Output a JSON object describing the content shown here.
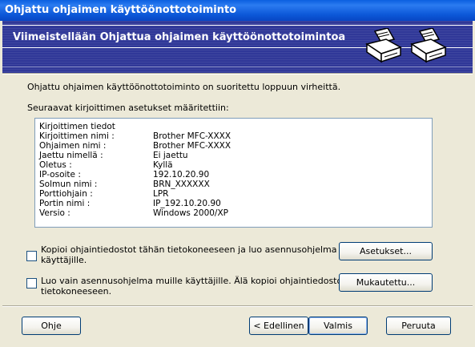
{
  "window": {
    "title": "Ohjattu ohjaimen käyttöönottotoiminto"
  },
  "header": {
    "title": "Viimeistellään Ohjattua ohjaimen käyttöönottotoimintoa",
    "icons": [
      "printer-icon",
      "printer-icon"
    ]
  },
  "main": {
    "intro": "Ohjattu ohjaimen käyttöönottotoiminto on suoritettu loppuun virheittä.",
    "settings_caption": "Seuraavat kirjoittimen asetukset määritettiin:",
    "list_header": "Kirjoittimen tiedot",
    "rows": [
      {
        "key": "Kirjoittimen nimi :",
        "value": "Brother MFC-XXXX"
      },
      {
        "key": "Ohjaimen nimi :",
        "value": "Brother MFC-XXXX"
      },
      {
        "key": "Jaettu nimellä :",
        "value": "Ei jaettu"
      },
      {
        "key": "Oletus :",
        "value": "Kyllä"
      },
      {
        "key": "IP-osoite :",
        "value": "192.10.20.90"
      },
      {
        "key": "Solmun nimi :",
        "value": "BRN_XXXXXX"
      },
      {
        "key": "Porttiohjain :",
        "value": "LPR"
      },
      {
        "key": "Portin nimi :",
        "value": "IP_192.10.20.90"
      },
      {
        "key": "Versio :",
        "value": "Windows 2000/XP"
      }
    ]
  },
  "options": {
    "copy_drivers": {
      "line1": "Kopioi ohjaintiedostot tähän tietokoneeseen ja luo asennusohjelma muille",
      "line2": "käyttäjille.",
      "checked": false
    },
    "installer_only": {
      "line1": "Luo vain asennusohjelma muille käyttäjille. Älä kopioi ohjaintiedostoja tähän",
      "line2": "tietokoneeseen.",
      "checked": false
    },
    "settings_button": "Asetukset...",
    "customize_button": "Mukautettu..."
  },
  "footer": {
    "help_button": "Ohje",
    "back_button": "< Edellinen",
    "finish_button": "Valmis",
    "cancel_button": "Peruuta"
  }
}
